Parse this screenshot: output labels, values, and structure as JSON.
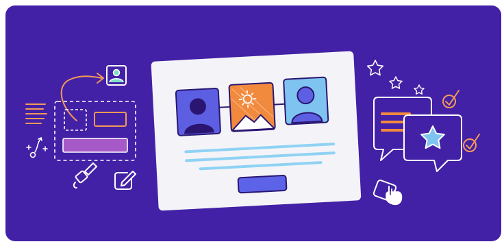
{
  "illustration": {
    "type": "web-design-banner",
    "colors": {
      "background": "#4321a6",
      "card": "#f4f4f8",
      "card_border": "#2a1670",
      "avatar_blue": "#5d5fe3",
      "avatar_light": "#7fc4f0",
      "image_orange": "#f28a3e",
      "line_cyan": "#8fd2f4",
      "button_blue": "#5c63e8",
      "pink_bar": "#a65ac8",
      "accent_orange": "#f59a57",
      "white": "#ffffff"
    },
    "icons": [
      "text-lines-icon",
      "curved-arrow-icon",
      "user-photo-icon",
      "layout-wireframe-icon",
      "sparkle-path-icon",
      "paint-brush-icon",
      "edit-pencil-icon",
      "webpage-card",
      "star-icon",
      "check-badge-icon",
      "chat-bubble-icon",
      "star-chat-bubble-icon",
      "tap-hand-icon"
    ]
  }
}
